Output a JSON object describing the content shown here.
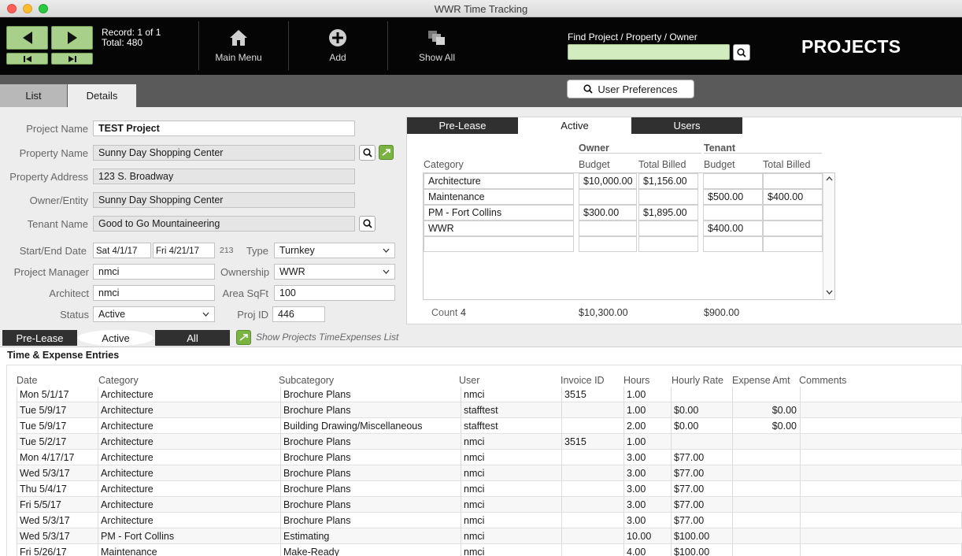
{
  "window": {
    "title": "WWR Time Tracking"
  },
  "toolbar": {
    "record_text": "Record: 1 of 1",
    "total_text": "Total: 480",
    "main_menu": "Main Menu",
    "add": "Add",
    "show_all": "Show All",
    "find_label": "Find Project / Property / Owner",
    "find_value": "",
    "page_title": "PROJECTS"
  },
  "view_tabs": {
    "list": "List",
    "details": "Details"
  },
  "user_preferences": "User Preferences",
  "form": {
    "project_name_label": "Project Name",
    "project_name": "TEST Project",
    "property_name_label": "Property Name",
    "property_name": "Sunny Day Shopping Center",
    "property_address_label": "Property Address",
    "property_address": "123 S. Broadway",
    "owner_label": "Owner/Entity",
    "owner": "Sunny Day Shopping Center",
    "tenant_label": "Tenant Name",
    "tenant": "Good to Go Mountaineering",
    "dates_label": "Start/End Date",
    "start_date": "Sat 4/1/17",
    "end_date": "Fri 4/21/17",
    "days": "213",
    "type_label": "Type",
    "type": "Turnkey",
    "pm_label": "Project Manager",
    "pm": "nmci",
    "ownership_label": "Ownership",
    "ownership": "WWR",
    "architect_label": "Architect",
    "architect": "nmci",
    "area_label": "Area SqFt",
    "area": "100",
    "status_label": "Status",
    "status": "Active",
    "projid_label": "Proj ID",
    "projid": "446"
  },
  "budget": {
    "tabs": {
      "prelease": "Pre-Lease",
      "active": "Active",
      "users": "Users"
    },
    "owner_header": "Owner",
    "tenant_header": "Tenant",
    "col_category": "Category",
    "col_owner_budget": "Budget",
    "col_owner_billed": "Total Billed",
    "col_tenant_budget": "Budget",
    "col_tenant_billed": "Total Billed",
    "rows": [
      {
        "category": "Architecture",
        "owner_budget": "$10,000.00",
        "owner_billed": "$1,156.00",
        "tenant_budget": "",
        "tenant_billed": ""
      },
      {
        "category": "Maintenance",
        "owner_budget": "",
        "owner_billed": "",
        "tenant_budget": "$500.00",
        "tenant_billed": "$400.00"
      },
      {
        "category": "PM - Fort Collins",
        "owner_budget": "$300.00",
        "owner_billed": "$1,895.00",
        "tenant_budget": "",
        "tenant_billed": ""
      },
      {
        "category": "WWR",
        "owner_budget": "",
        "owner_billed": "",
        "tenant_budget": "$400.00",
        "tenant_billed": ""
      },
      {
        "category": "",
        "owner_budget": "",
        "owner_billed": "",
        "tenant_budget": "",
        "tenant_billed": ""
      }
    ],
    "count_label": "Count",
    "count": "4",
    "owner_total": "$10,300.00",
    "tenant_total": "$900.00"
  },
  "entries_tabs": {
    "prelease": "Pre-Lease",
    "active": "Active",
    "all": "All",
    "show_list": "Show Projects TimeExpenses List"
  },
  "entries": {
    "title": "Time & Expense Entries",
    "columns": {
      "date": "Date",
      "category": "Category",
      "subcategory": "Subcategory",
      "user": "User",
      "invoice": "Invoice ID",
      "hours": "Hours",
      "rate": "Hourly Rate",
      "expense": "Expense Amt",
      "comments": "Comments"
    },
    "rows": [
      {
        "date": "Mon 5/1/17",
        "category": "Architecture",
        "subcategory": "Brochure Plans",
        "user": "nmci",
        "invoice": "3515",
        "hours": "1.00",
        "rate": "",
        "expense": "",
        "comments": ""
      },
      {
        "date": "Tue 5/9/17",
        "category": "Architecture",
        "subcategory": "Brochure Plans",
        "user": "stafftest",
        "invoice": "",
        "hours": "1.00",
        "rate": "$0.00",
        "expense": "$0.00",
        "comments": ""
      },
      {
        "date": "Tue 5/9/17",
        "category": "Architecture",
        "subcategory": "Building Drawing/Miscellaneous",
        "user": "stafftest",
        "invoice": "",
        "hours": "2.00",
        "rate": "$0.00",
        "expense": "$0.00",
        "comments": ""
      },
      {
        "date": "Tue 5/2/17",
        "category": "Architecture",
        "subcategory": "Brochure Plans",
        "user": "nmci",
        "invoice": "3515",
        "hours": "1.00",
        "rate": "",
        "expense": "",
        "comments": ""
      },
      {
        "date": "Mon 4/17/17",
        "category": "Architecture",
        "subcategory": "Brochure Plans",
        "user": "nmci",
        "invoice": "",
        "hours": "3.00",
        "rate": "$77.00",
        "expense": "",
        "comments": ""
      },
      {
        "date": "Wed 5/3/17",
        "category": "Architecture",
        "subcategory": "Brochure Plans",
        "user": "nmci",
        "invoice": "",
        "hours": "3.00",
        "rate": "$77.00",
        "expense": "",
        "comments": ""
      },
      {
        "date": "Thu 5/4/17",
        "category": "Architecture",
        "subcategory": "Brochure Plans",
        "user": "nmci",
        "invoice": "",
        "hours": "3.00",
        "rate": "$77.00",
        "expense": "",
        "comments": ""
      },
      {
        "date": "Fri 5/5/17",
        "category": "Architecture",
        "subcategory": "Brochure Plans",
        "user": "nmci",
        "invoice": "",
        "hours": "3.00",
        "rate": "$77.00",
        "expense": "",
        "comments": ""
      },
      {
        "date": "Wed 5/3/17",
        "category": "Architecture",
        "subcategory": "Brochure Plans",
        "user": "nmci",
        "invoice": "",
        "hours": "3.00",
        "rate": "$77.00",
        "expense": "",
        "comments": ""
      },
      {
        "date": "Wed 5/3/17",
        "category": "PM - Fort Collins",
        "subcategory": "Estimating",
        "user": "nmci",
        "invoice": "",
        "hours": "10.00",
        "rate": "$100.00",
        "expense": "",
        "comments": ""
      },
      {
        "date": "Fri 5/26/17",
        "category": "Maintenance",
        "subcategory": "Make-Ready",
        "user": "nmci",
        "invoice": "",
        "hours": "4.00",
        "rate": "$100.00",
        "expense": "",
        "comments": ""
      }
    ]
  },
  "colors": {
    "nav_green": "#a8d08a",
    "find_green": "#d2ecbf",
    "action_green": "#7bb342",
    "toolbar_black": "#050505"
  }
}
